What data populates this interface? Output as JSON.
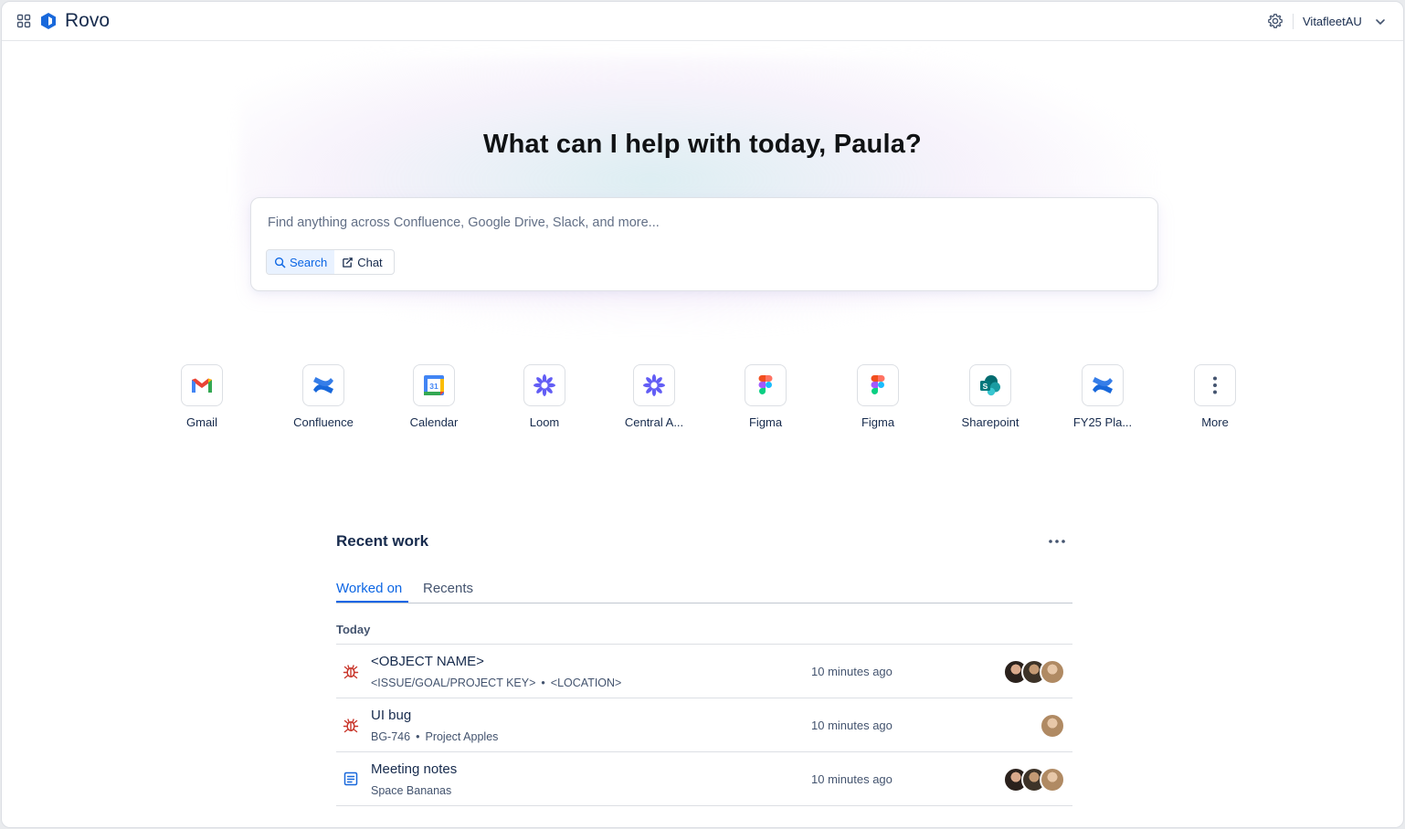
{
  "header": {
    "logo_text": "Rovo",
    "workspace": "VitafleetAU"
  },
  "hero": {
    "title": "What can I help with today, Paula?",
    "search_placeholder": "Find anything across Confluence, Google Drive, Slack, and more...",
    "modes": [
      {
        "label": "Search",
        "icon": "search-icon",
        "active": true
      },
      {
        "label": "Chat",
        "icon": "chat-icon",
        "active": false
      }
    ]
  },
  "apps": [
    {
      "label": "Gmail",
      "icon": "gmail-icon"
    },
    {
      "label": "Confluence",
      "icon": "confluence-icon"
    },
    {
      "label": "Calendar",
      "icon": "google-calendar-icon",
      "badge": "31"
    },
    {
      "label": "Loom",
      "icon": "loom-icon"
    },
    {
      "label": "Central A...",
      "icon": "loom-icon"
    },
    {
      "label": "Figma",
      "icon": "figma-icon"
    },
    {
      "label": "Figma",
      "icon": "figma-icon"
    },
    {
      "label": "Sharepoint",
      "icon": "sharepoint-icon",
      "badge": "S"
    },
    {
      "label": "FY25 Pla...",
      "icon": "confluence-icon"
    },
    {
      "label": "More",
      "icon": "more-vertical-icon"
    }
  ],
  "recent": {
    "title": "Recent work",
    "tabs": [
      {
        "label": "Worked on",
        "active": true
      },
      {
        "label": "Recents",
        "active": false
      }
    ],
    "group_label": "Today",
    "items": [
      {
        "icon": "bug-icon",
        "title": "<OBJECT NAME>",
        "key": "<ISSUE/GOAL/PROJECT KEY>",
        "location": "<LOCATION>",
        "time": "10 minutes ago",
        "avatars": 3
      },
      {
        "icon": "bug-icon",
        "title": "UI bug",
        "key": "BG-746",
        "location": "Project Apples",
        "time": "10 minutes ago",
        "avatars": 1
      },
      {
        "icon": "page-icon",
        "title": "Meeting notes",
        "key": "Space Bananas",
        "location": "",
        "time": "10 minutes ago",
        "avatars": 3
      }
    ]
  },
  "colors": {
    "accent": "#0c66e4",
    "bug": "#c9372c",
    "text": "#172b4d"
  }
}
